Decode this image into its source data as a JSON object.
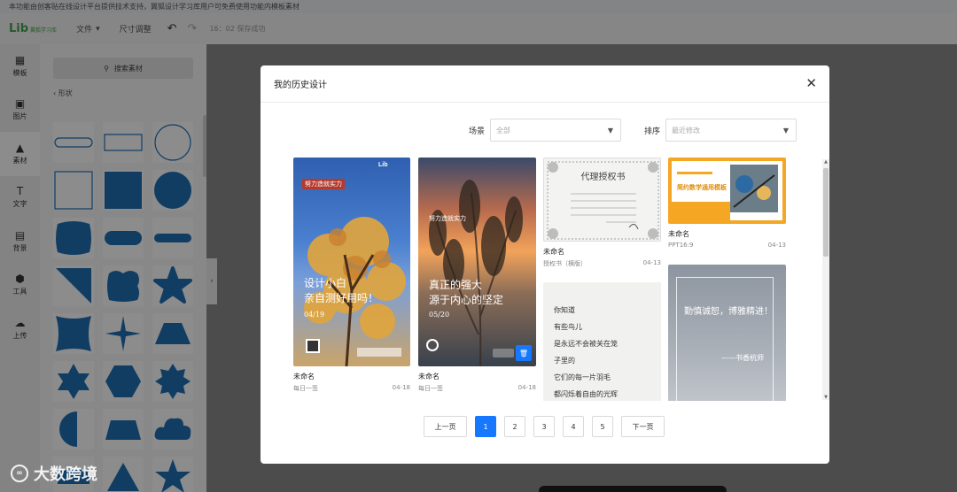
{
  "notice": "本功能由创客贴在线设计平台提供技术支持，翼狐设计学习库用户可免费使用功能内模板素材",
  "toolbar": {
    "logo": "Lib",
    "logo_sub": "翼狐学习库",
    "file": "文件",
    "resize": "尺寸调整",
    "saved": "16：02 保存成功"
  },
  "rail": [
    {
      "label": "模板",
      "icon": "template-icon",
      "glyph": "▦"
    },
    {
      "label": "图片",
      "icon": "image-icon",
      "glyph": "▣"
    },
    {
      "label": "素材",
      "icon": "elements-icon",
      "glyph": "▲"
    },
    {
      "label": "文字",
      "icon": "text-icon",
      "glyph": "T"
    },
    {
      "label": "背景",
      "icon": "background-icon",
      "glyph": "▤"
    },
    {
      "label": "工具",
      "icon": "tools-icon",
      "glyph": "⬢"
    },
    {
      "label": "上传",
      "icon": "upload-icon",
      "glyph": "☁"
    }
  ],
  "panel": {
    "search": "搜索素材",
    "back": "形状"
  },
  "modal": {
    "title": "我的历史设计",
    "scene_label": "场景",
    "scene_value": "全部",
    "sort_label": "排序",
    "sort_value": "最近修改"
  },
  "designs": [
    {
      "title": "未命名",
      "type": "每日一签",
      "date": "04-18",
      "headline": "设计小白\n亲自测好用吗！",
      "date_text": "04/19",
      "top_text": "努力造就实力"
    },
    {
      "title": "未命名",
      "type": "每日一签",
      "date": "04-18",
      "headline": "真正的强大\n源于内心的坚定",
      "date_text": "05/20",
      "top_text": "努力造就实力"
    },
    {
      "title": "未命名",
      "type": "授权书（横版）",
      "date": "04-13",
      "headline": "代理授权书"
    },
    {
      "title": "未命名",
      "type": "PPT16:9",
      "date": "04-13",
      "headline": "简约数学通用模板"
    },
    {
      "title": "",
      "type": "",
      "date": "",
      "poem": [
        "你知道",
        "有些鸟儿",
        "是永远不会被关在笼",
        "子里的",
        "它们的每一片羽毛",
        "都闪烁着自由的光辉"
      ]
    },
    {
      "title": "",
      "type": "",
      "date": "",
      "quote": "勤慎诚恕，博雅精进！",
      "author": "——书香杭师"
    }
  ],
  "pagination": {
    "prev": "上一页",
    "next": "下一页",
    "pages": [
      "1",
      "2",
      "3",
      "4",
      "5"
    ],
    "current": "1"
  },
  "watermark": "大数跨境",
  "colors": {
    "accent": "#1677ff",
    "shape_blue": "#1f6fb5",
    "logo_green": "#4aa34e"
  }
}
